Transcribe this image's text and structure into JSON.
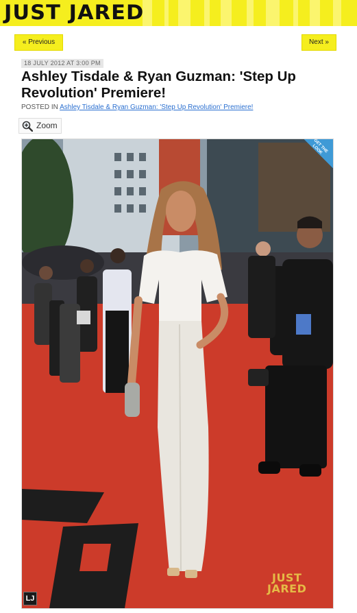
{
  "site": {
    "logo_text": "JUST JARED",
    "brand_color": "#f5ee1e"
  },
  "nav": {
    "previous_label": "« Previous",
    "next_label": "Next »"
  },
  "post": {
    "date": "18 JULY 2012 AT 3:00 PM",
    "title": "Ashley Tisdale & Ryan Guzman: 'Step Up Revolution' Premiere!",
    "posted_in_label": "POSTED IN",
    "category_link": "Ashley Tisdale & Ryan Guzman: 'Step Up Revolution' Premiere!"
  },
  "toolbar": {
    "zoom_label": "Zoom",
    "zoom_icon": "magnifier-plus-icon"
  },
  "photo": {
    "corner_tag": "GET THE LOOK",
    "watermark_line1": "JUST",
    "watermark_line2": "JARED",
    "badge_text": "LJ"
  },
  "colors": {
    "carpet": "#cc3b2a",
    "link": "#2a6fd0",
    "corner_tag": "#3f9ad6"
  }
}
